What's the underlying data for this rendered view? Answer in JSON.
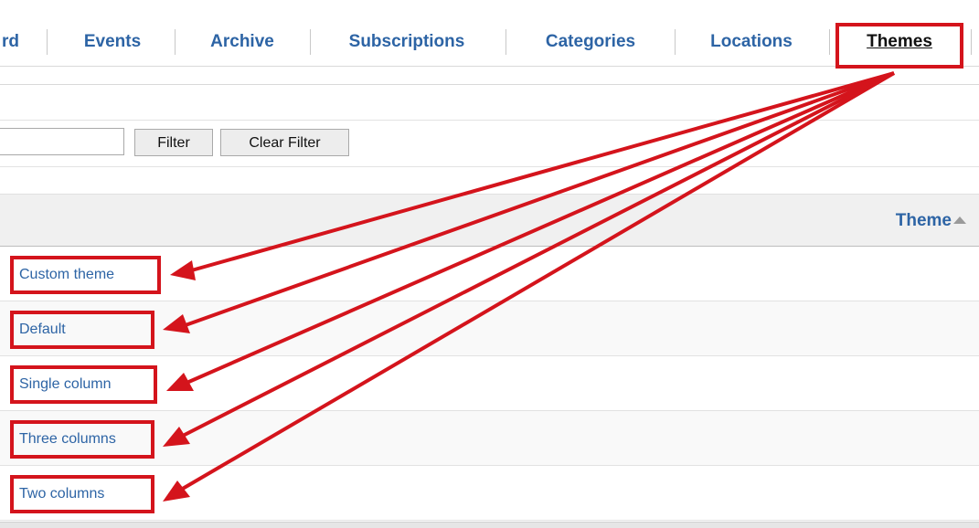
{
  "tabs": [
    {
      "label": "rd"
    },
    {
      "label": "Events"
    },
    {
      "label": "Archive"
    },
    {
      "label": "Subscriptions"
    },
    {
      "label": "Categories"
    },
    {
      "label": "Locations"
    },
    {
      "label": "Themes",
      "active": true
    }
  ],
  "filter": {
    "input_value": "",
    "filter_button": "Filter",
    "clear_button": "Clear Filter"
  },
  "table": {
    "column_header": "Theme",
    "sort_direction": "ascending",
    "rows": [
      {
        "name": "Custom theme"
      },
      {
        "name": "Default"
      },
      {
        "name": "Single column"
      },
      {
        "name": "Three columns"
      },
      {
        "name": "Two columns"
      }
    ]
  },
  "colors": {
    "link": "#2d64a5",
    "annotation": "#d4141c"
  },
  "icons": {
    "sort": "triangle-up-icon"
  }
}
